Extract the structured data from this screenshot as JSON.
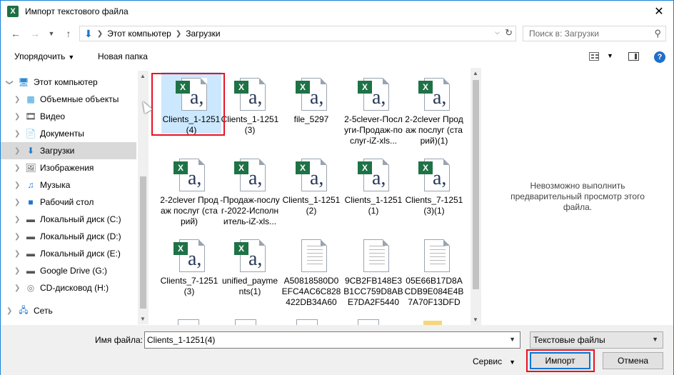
{
  "window": {
    "title": "Импорт текстового файла",
    "close_glyph": "✕"
  },
  "address": {
    "crumbs": [
      "Этот компьютер",
      "Загрузки"
    ],
    "search_placeholder": "Поиск в: Загрузки"
  },
  "toolbar": {
    "organize_label": "Упорядочить",
    "new_folder_label": "Новая папка"
  },
  "nav": {
    "items": [
      {
        "label": "Этот компьютер",
        "icon": "computer-icon"
      },
      {
        "label": "Объемные объекты",
        "icon": "3d-objects-icon"
      },
      {
        "label": "Видео",
        "icon": "video-icon"
      },
      {
        "label": "Документы",
        "icon": "documents-icon"
      },
      {
        "label": "Загрузки",
        "icon": "downloads-icon"
      },
      {
        "label": "Изображения",
        "icon": "pictures-icon"
      },
      {
        "label": "Музыка",
        "icon": "music-icon"
      },
      {
        "label": "Рабочий стол",
        "icon": "desktop-icon"
      },
      {
        "label": "Локальный диск (C:)",
        "icon": "drive-icon"
      },
      {
        "label": "Локальный диск (D:)",
        "icon": "drive-icon"
      },
      {
        "label": "Локальный диск (E:)",
        "icon": "drive-icon"
      },
      {
        "label": "Google Drive (G:)",
        "icon": "drive-icon"
      },
      {
        "label": "CD-дисковод (H:)",
        "icon": "cd-drive-icon"
      },
      {
        "label": "Сеть",
        "icon": "network-icon"
      }
    ]
  },
  "files": [
    {
      "name": "Clients_1-1251(4)",
      "type": "excel"
    },
    {
      "name": "Clients_1-1251(3)",
      "type": "excel"
    },
    {
      "name": "file_5297",
      "type": "excel"
    },
    {
      "name": "2-5clever-Послуги-Продаж-послуг-iZ-xls...",
      "type": "excel"
    },
    {
      "name": "2-2clever Продаж послуг (старий)(1)",
      "type": "excel"
    },
    {
      "name": "2-2clever Продаж послуг (старий)",
      "type": "excel"
    },
    {
      "name": "-Продаж-послуг-2022-Исполнитель-iZ-xls...",
      "type": "excel"
    },
    {
      "name": "Clients_1-1251(2)",
      "type": "excel"
    },
    {
      "name": "Clients_1-1251(1)",
      "type": "excel"
    },
    {
      "name": "Clients_7-1251 (3)(1)",
      "type": "excel"
    },
    {
      "name": "Clients_7-1251 (3)",
      "type": "excel"
    },
    {
      "name": "unified_payments(1)",
      "type": "excel"
    },
    {
      "name": "A50818580D0EFC4AC6C828422DB34A60",
      "type": "text"
    },
    {
      "name": "9CB2FB148E3B1CC759D8ABE7DA2F5440",
      "type": "text"
    },
    {
      "name": "05E66B17D8ACDB9E084E4B7A70F13DFD",
      "type": "text"
    }
  ],
  "preview_text": "Невозможно выполнить предварительный просмотр этого файла.",
  "bottom": {
    "filename_label": "Имя файла:",
    "filename_value": "Clients_1-1251(4)",
    "filetype_value": "Текстовые файлы",
    "service_label": "Сервис",
    "import_label": "Импорт",
    "cancel_label": "Отмена"
  },
  "colors": {
    "accent": "#0078d7",
    "highlight": "#e81123",
    "excel_green": "#1f7246",
    "selection": "#cce8ff"
  }
}
